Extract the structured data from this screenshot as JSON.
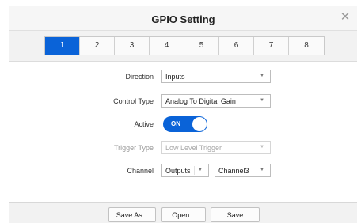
{
  "dialog": {
    "title": "GPIO Setting",
    "close_icon": "close-icon"
  },
  "tabs": [
    {
      "label": "1",
      "active": true
    },
    {
      "label": "2"
    },
    {
      "label": "3"
    },
    {
      "label": "4"
    },
    {
      "label": "5"
    },
    {
      "label": "6"
    },
    {
      "label": "7"
    },
    {
      "label": "8"
    }
  ],
  "form": {
    "direction": {
      "label": "Direction",
      "value": "Inputs"
    },
    "control_type": {
      "label": "Control Type",
      "value": "Analog To Digital Gain"
    },
    "active": {
      "label": "Active",
      "state": "ON"
    },
    "trigger_type": {
      "label": "Trigger Type",
      "value": "Low Level Trigger",
      "disabled": true
    },
    "channel": {
      "label": "Channel",
      "direction_value": "Outputs",
      "channel_value": "Channel3"
    }
  },
  "footer": {
    "save_as_label": "Save As...",
    "open_label": "Open...",
    "save_label": "Save"
  },
  "colors": {
    "accent": "#0a63d8"
  }
}
